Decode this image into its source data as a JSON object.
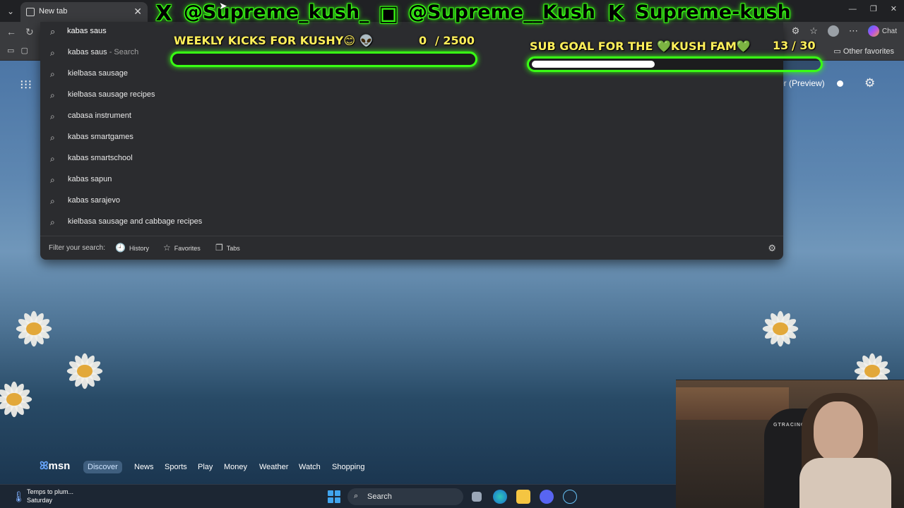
{
  "browser": {
    "tab_title": "New tab",
    "favorites_bar": {
      "other_favorites": "Other favorites"
    },
    "toolbar": {
      "chat_label": "Chat"
    }
  },
  "omnibox": {
    "query": "kabas saus",
    "suggestions": [
      {
        "text": "kabas saus",
        "suffix": " - Search"
      },
      {
        "text": "kielbasa sausage"
      },
      {
        "text": "kielbasa sausage recipes"
      },
      {
        "text": "cabasa instrument"
      },
      {
        "text": "kabas smartgames"
      },
      {
        "text": "kabas smartschool"
      },
      {
        "text": "kabas sapun"
      },
      {
        "text": "kabas sarajevo"
      },
      {
        "text": "kielbasa sausage and cabbage recipes"
      }
    ],
    "filter_label": "Filter your search:",
    "filters": [
      {
        "label": "History",
        "icon": "history-icon"
      },
      {
        "label": "Favorites",
        "icon": "star-icon"
      },
      {
        "label": "Tabs",
        "icon": "tabs-icon"
      }
    ]
  },
  "ntp": {
    "preview_label": "ver (Preview)",
    "msn_logo": "msn",
    "msn_tabs": [
      "Discover",
      "News",
      "Sports",
      "Play",
      "Money",
      "Weather",
      "Watch",
      "Shopping"
    ],
    "msn_active_tab": "Discover"
  },
  "taskbar": {
    "weather_line1": "Temps to plum...",
    "weather_line2": "Saturday",
    "search_label": "Search"
  },
  "overlay": {
    "x_handle": "@Supreme_kush_",
    "twitch_handle": "@Supreme__Kush",
    "kick_handle": "Supreme-kush",
    "kicks_goal": {
      "title": "WEEKLY KICKS FOR KUSHY😊 👽",
      "current": "0",
      "total": "/ 2500",
      "progress": 0
    },
    "sub_goal": {
      "title": "SUB GOAL FOR THE 💚KUSH FAM💚",
      "current": "13",
      "total": "/ 30",
      "progress": 0.43
    }
  },
  "colors": {
    "overlay_green": "#39ff14",
    "overlay_yellow": "#ffef5a",
    "omnibox_bg": "#2b2c2f",
    "chrome_bg": "#3a3b3e"
  }
}
